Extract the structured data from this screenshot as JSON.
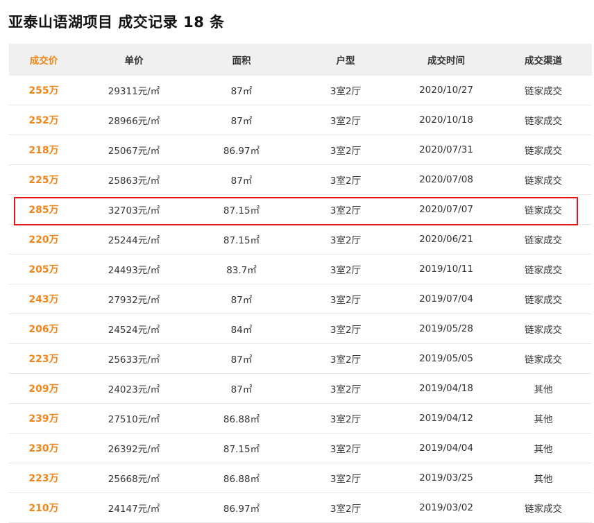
{
  "title": "亚泰山语湖项目 成交记录 18 条",
  "colors": {
    "accent": "#f08519",
    "highlight": "#e8141b",
    "header_bg": "#f0f0f0"
  },
  "table": {
    "headers": [
      "成交价",
      "单价",
      "面积",
      "户型",
      "成交时间",
      "成交渠道"
    ],
    "rows": [
      {
        "price": "255万",
        "unit_price": "29311元/㎡",
        "area": "87㎡",
        "layout": "3室2厅",
        "date": "2020/10/27",
        "channel": "链家成交"
      },
      {
        "price": "252万",
        "unit_price": "28966元/㎡",
        "area": "87㎡",
        "layout": "3室2厅",
        "date": "2020/10/18",
        "channel": "链家成交"
      },
      {
        "price": "218万",
        "unit_price": "25067元/㎡",
        "area": "86.97㎡",
        "layout": "3室2厅",
        "date": "2020/07/31",
        "channel": "链家成交"
      },
      {
        "price": "225万",
        "unit_price": "25863元/㎡",
        "area": "87㎡",
        "layout": "3室2厅",
        "date": "2020/07/08",
        "channel": "链家成交"
      },
      {
        "price": "285万",
        "unit_price": "32703元/㎡",
        "area": "87.15㎡",
        "layout": "3室2厅",
        "date": "2020/07/07",
        "channel": "链家成交"
      },
      {
        "price": "220万",
        "unit_price": "25244元/㎡",
        "area": "87.15㎡",
        "layout": "3室2厅",
        "date": "2020/06/21",
        "channel": "链家成交"
      },
      {
        "price": "205万",
        "unit_price": "24493元/㎡",
        "area": "83.7㎡",
        "layout": "3室2厅",
        "date": "2019/10/11",
        "channel": "链家成交"
      },
      {
        "price": "243万",
        "unit_price": "27932元/㎡",
        "area": "87㎡",
        "layout": "3室2厅",
        "date": "2019/07/04",
        "channel": "链家成交"
      },
      {
        "price": "206万",
        "unit_price": "24524元/㎡",
        "area": "84㎡",
        "layout": "3室2厅",
        "date": "2019/05/28",
        "channel": "链家成交"
      },
      {
        "price": "223万",
        "unit_price": "25633元/㎡",
        "area": "87㎡",
        "layout": "3室2厅",
        "date": "2019/05/05",
        "channel": "链家成交"
      },
      {
        "price": "209万",
        "unit_price": "24023元/㎡",
        "area": "87㎡",
        "layout": "3室2厅",
        "date": "2019/04/18",
        "channel": "其他"
      },
      {
        "price": "239万",
        "unit_price": "27510元/㎡",
        "area": "86.88㎡",
        "layout": "3室2厅",
        "date": "2019/04/12",
        "channel": "其他"
      },
      {
        "price": "230万",
        "unit_price": "26392元/㎡",
        "area": "87.15㎡",
        "layout": "3室2厅",
        "date": "2019/04/04",
        "channel": "其他"
      },
      {
        "price": "223万",
        "unit_price": "25668元/㎡",
        "area": "86.88㎡",
        "layout": "3室2厅",
        "date": "2019/03/25",
        "channel": "其他"
      },
      {
        "price": "210万",
        "unit_price": "24147元/㎡",
        "area": "86.97㎡",
        "layout": "3室2厅",
        "date": "2019/03/02",
        "channel": "链家成交"
      }
    ]
  }
}
